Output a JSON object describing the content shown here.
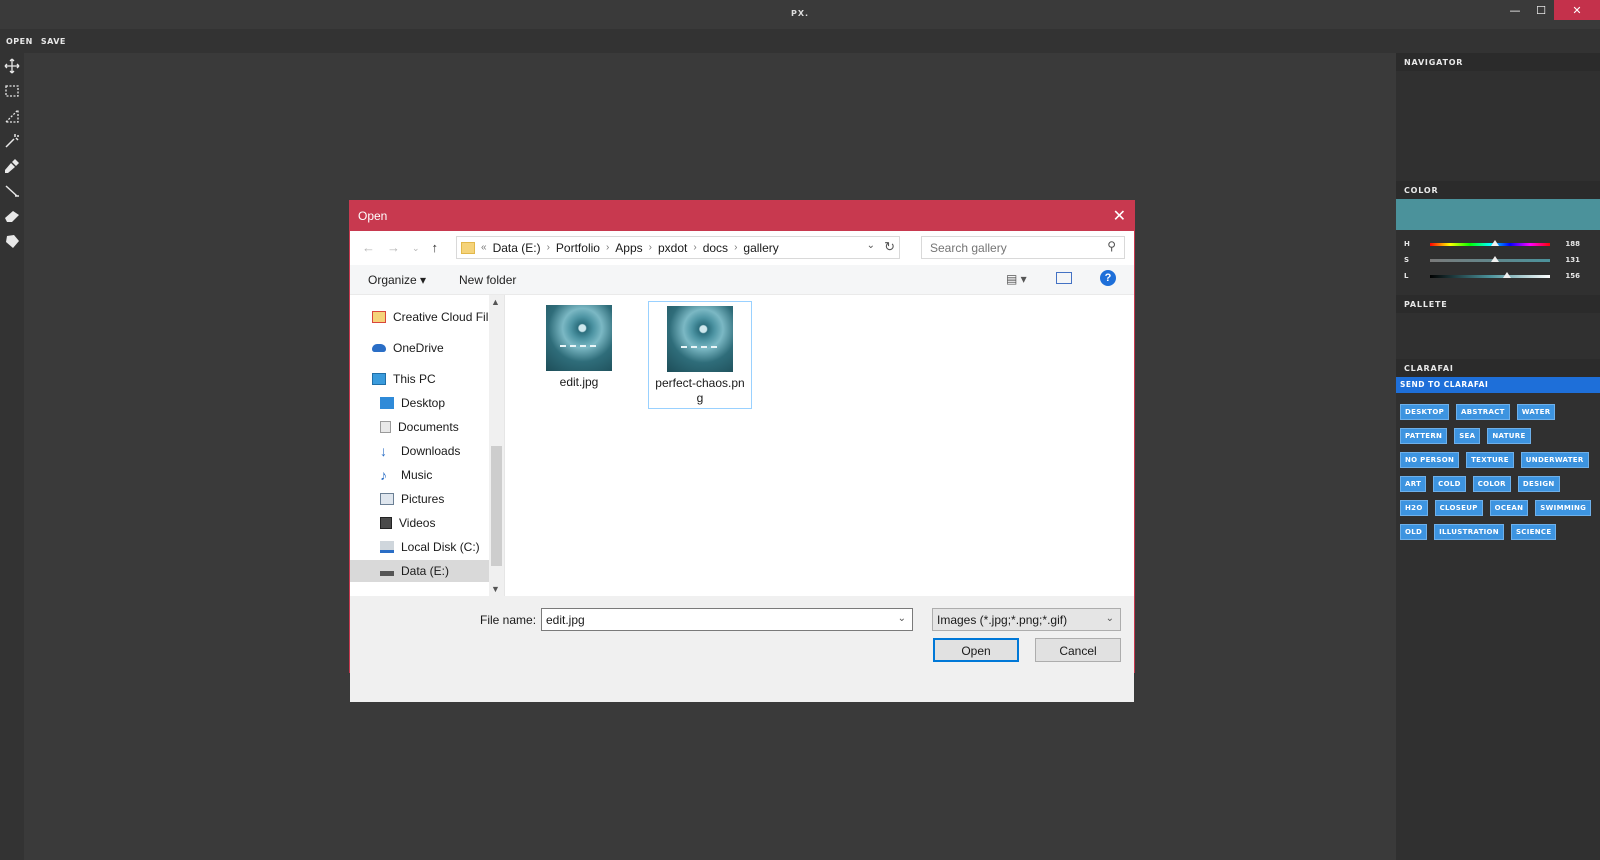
{
  "app": {
    "title": "PX.",
    "window_controls": {
      "minimize": "—",
      "maximize": "☐",
      "close": "✕"
    }
  },
  "menu": {
    "open": "OPEN",
    "save": "SAVE"
  },
  "toolbar": {
    "tools": [
      "move-tool",
      "rect-select-tool",
      "lasso-tool",
      "magic-wand-tool",
      "eyedropper-tool",
      "brush-tool",
      "eraser-tool",
      "fill-tool"
    ]
  },
  "right_panel": {
    "navigator_title": "NAVIGATOR",
    "color_title": "COLOR",
    "color_swatch": "#4b929b",
    "sliders": [
      {
        "label": "H",
        "value": "188",
        "level": 0.54
      },
      {
        "label": "S",
        "value": "131",
        "level": 0.54
      },
      {
        "label": "L",
        "value": "156",
        "level": 0.64
      }
    ],
    "palette_title": "PALLETE",
    "clarafai_title": "CLARAFAI",
    "send_button": "SEND TO CLARAFAI",
    "tags": [
      "DESKTOP",
      "ABSTRACT",
      "WATER",
      "PATTERN",
      "SEA",
      "NATURE",
      "NO PERSON",
      "TEXTURE",
      "UNDERWATER",
      "ART",
      "COLD",
      "COLOR",
      "DESIGN",
      "H2O",
      "CLOSEUP",
      "OCEAN",
      "SWIMMING",
      "OLD",
      "ILLUSTRATION",
      "SCIENCE"
    ]
  },
  "dialog": {
    "title": "Open",
    "close": "✕",
    "breadcrumb_prefix": "«",
    "breadcrumb": [
      "Data (E:)",
      "Portfolio",
      "Apps",
      "pxdot",
      "docs",
      "gallery"
    ],
    "search_placeholder": "Search gallery",
    "organize": "Organize ▾",
    "new_folder": "New folder",
    "help": "?",
    "nav_items": [
      {
        "label": "Creative Cloud Fil",
        "icon": "creative-cloud-folder-icon"
      },
      {
        "label": "OneDrive",
        "icon": "onedrive-icon"
      },
      {
        "label": "This PC",
        "icon": "computer-icon"
      },
      {
        "label": "Desktop",
        "icon": "desktop-folder-icon"
      },
      {
        "label": "Documents",
        "icon": "documents-folder-icon"
      },
      {
        "label": "Downloads",
        "icon": "downloads-folder-icon"
      },
      {
        "label": "Music",
        "icon": "music-folder-icon"
      },
      {
        "label": "Pictures",
        "icon": "pictures-folder-icon"
      },
      {
        "label": "Videos",
        "icon": "videos-folder-icon"
      },
      {
        "label": "Local Disk (C:)",
        "icon": "local-disk-icon"
      },
      {
        "label": "Data (E:)",
        "icon": "drive-icon"
      }
    ],
    "files": [
      {
        "name": "edit.jpg"
      },
      {
        "name": "perfect-chaos.png"
      }
    ],
    "file_name_label": "File name:",
    "file_name_value": "edit.jpg",
    "file_type": "Images (*.jpg;*.png;*.gif)",
    "open_button": "Open",
    "cancel_button": "Cancel"
  }
}
